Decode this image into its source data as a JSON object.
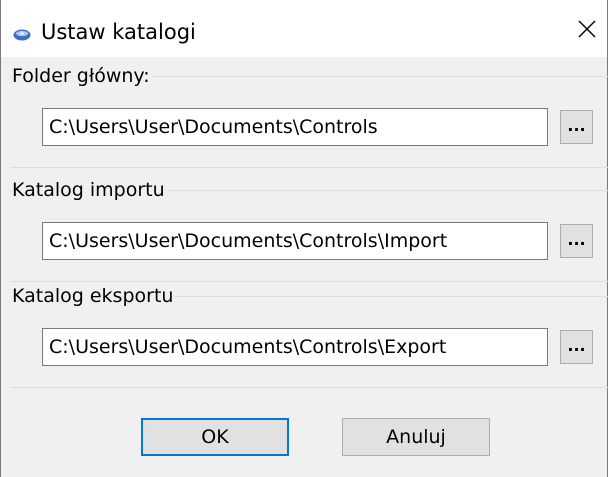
{
  "window": {
    "title": "Ustaw katalogi",
    "icon": "disc-icon",
    "close_glyph": "close-icon"
  },
  "groups": [
    {
      "label": "Folder główny:",
      "value": "C:\\Users\\User\\Documents\\Controls",
      "browse_label": "..."
    },
    {
      "label": "Katalog importu",
      "value": "C:\\Users\\User\\Documents\\Controls\\Import",
      "browse_label": "..."
    },
    {
      "label": "Katalog eksportu",
      "value": "C:\\Users\\User\\Documents\\Controls\\Export",
      "browse_label": "..."
    }
  ],
  "buttons": {
    "ok_label": "OK",
    "cancel_label": "Anuluj"
  },
  "colors": {
    "default_button_border": "#0078d7",
    "dialog_background": "#f0f0f0"
  }
}
